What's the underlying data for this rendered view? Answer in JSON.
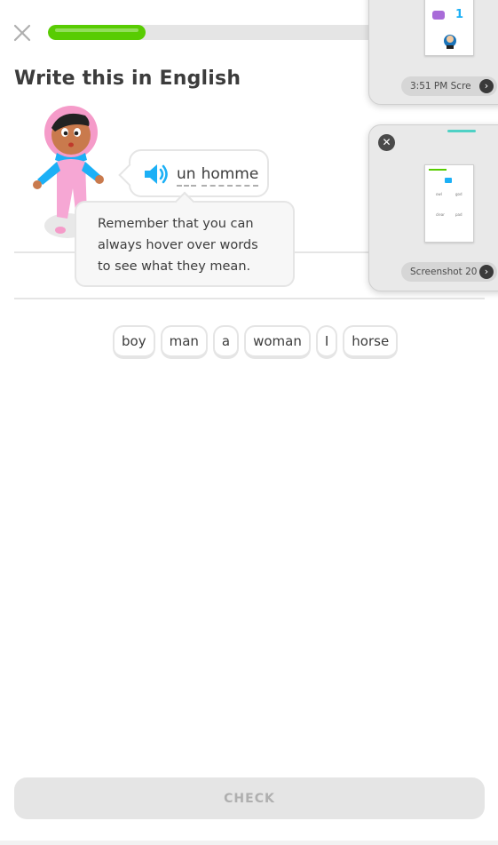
{
  "lesson": {
    "progress_fraction": 0.22,
    "title": "Write this in English",
    "prompt_words": [
      "un",
      "homme"
    ],
    "tooltip": "Remember that you can always hover over words to see what they mean.",
    "word_bank": [
      "boy",
      "man",
      "a",
      "woman",
      "I",
      "horse"
    ],
    "check_label": "CHECK"
  },
  "overlay": {
    "panel1": {
      "thumb_number": "1",
      "label": "3:51 PM  Scre"
    },
    "panel2": {
      "label": "Screenshot 20",
      "mini_words": [
        "owl",
        "god",
        "clear",
        "pad"
      ]
    }
  },
  "colors": {
    "accent_green": "#58cc02",
    "border_gray": "#e5e5e5",
    "speaker_blue": "#1cb0f6",
    "handle_teal": "#4fd1c5"
  }
}
